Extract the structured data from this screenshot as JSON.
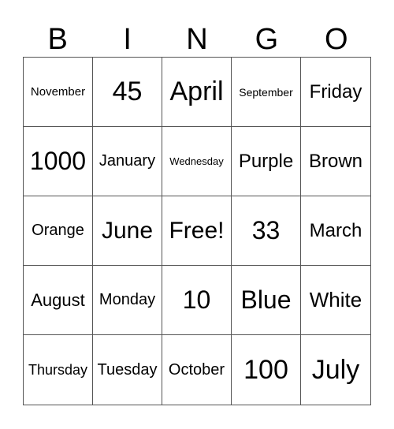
{
  "header": [
    "B",
    "I",
    "N",
    "G",
    "O"
  ],
  "cells": [
    [
      "November",
      "45",
      "April",
      "September",
      "Friday"
    ],
    [
      "1000",
      "January",
      "Wednesday",
      "Purple",
      "Brown"
    ],
    [
      "Orange",
      "June",
      "Free!",
      "33",
      "March"
    ],
    [
      "August",
      "Monday",
      "10",
      "Blue",
      "White"
    ],
    [
      "Thursday",
      "Tuesday",
      "October",
      "100",
      "July"
    ]
  ]
}
